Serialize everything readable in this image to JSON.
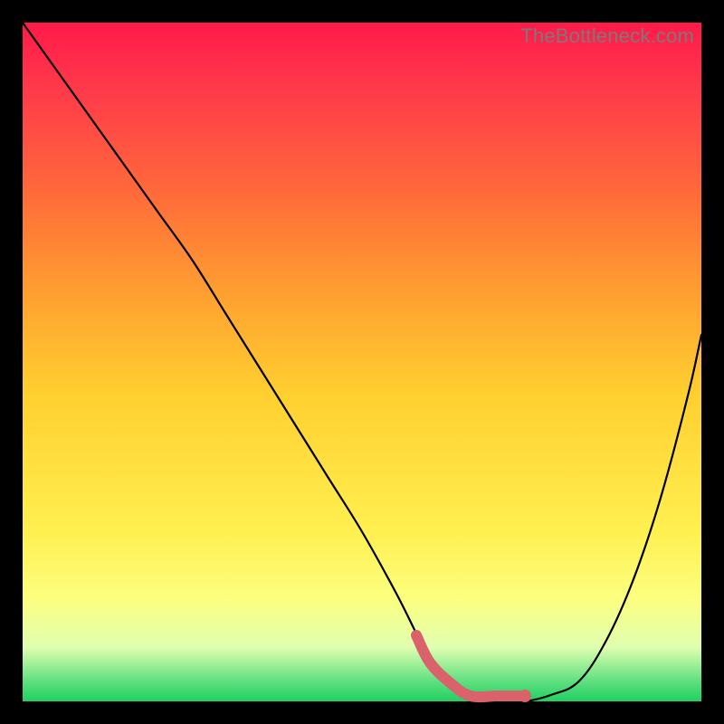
{
  "watermark": "TheBottleneck.com",
  "chart_data": {
    "type": "line",
    "title": "",
    "xlabel": "",
    "ylabel": "",
    "xlim": [
      0,
      100
    ],
    "ylim": [
      0,
      100
    ],
    "grid": false,
    "legend": false,
    "series": [
      {
        "name": "curve",
        "x": [
          0,
          5,
          10,
          15,
          20,
          25,
          30,
          35,
          40,
          45,
          50,
          55,
          58,
          60,
          63,
          66,
          70,
          74,
          78,
          82,
          86,
          90,
          94,
          98,
          100
        ],
        "y": [
          100,
          93,
          86,
          79,
          72,
          65,
          57,
          49,
          41,
          33,
          25,
          16,
          10,
          6,
          3,
          1,
          0,
          0,
          1,
          3,
          9,
          18,
          30,
          45,
          54
        ]
      }
    ],
    "highlight_segment": {
      "from_index": 12,
      "to_index": 17,
      "end_dot_index": 17
    },
    "colors": {
      "background_gradient_top": "#ff1a4a",
      "background_gradient_bottom": "#20d060",
      "curve": "#000000",
      "highlight": "#d9626b",
      "frame": "#000000"
    }
  }
}
